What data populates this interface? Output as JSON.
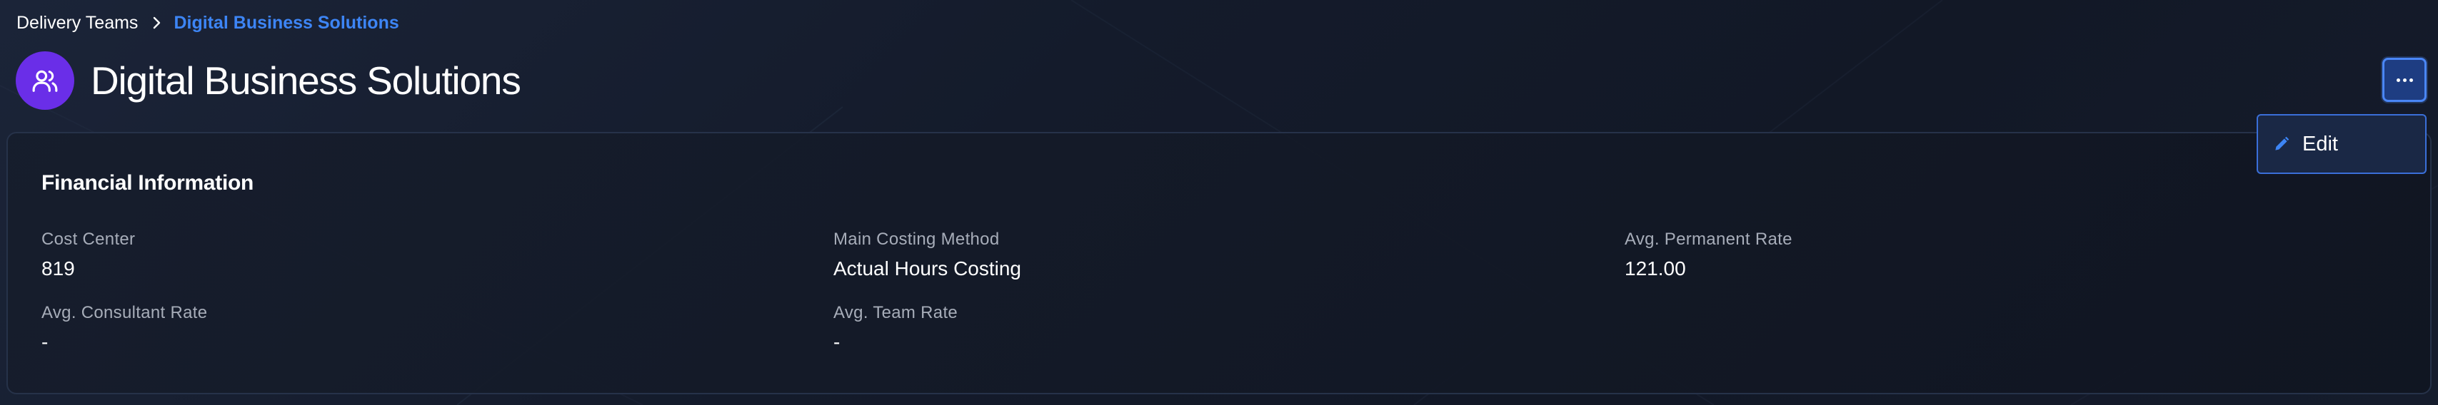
{
  "breadcrumb": {
    "parent": "Delivery Teams",
    "current": "Digital Business Solutions"
  },
  "header": {
    "title": "Digital Business Solutions",
    "avatar_icon": "users-icon",
    "avatar_color": "#6a2ee8",
    "more_button_icon": "more-horizontal-icon"
  },
  "menu": {
    "items": [
      {
        "label": "Edit",
        "icon": "pencil-icon"
      }
    ]
  },
  "card": {
    "title": "Financial Information",
    "fields": [
      {
        "label": "Cost Center",
        "value": "819"
      },
      {
        "label": "Main Costing Method",
        "value": "Actual Hours Costing"
      },
      {
        "label": "Avg. Permanent Rate",
        "value": "121.00"
      },
      {
        "label": "Avg. Consultant Rate",
        "value": "-"
      },
      {
        "label": "Avg. Team Rate",
        "value": "-"
      }
    ]
  },
  "colors": {
    "accent": "#3d85f5",
    "background": "#141b2b"
  }
}
